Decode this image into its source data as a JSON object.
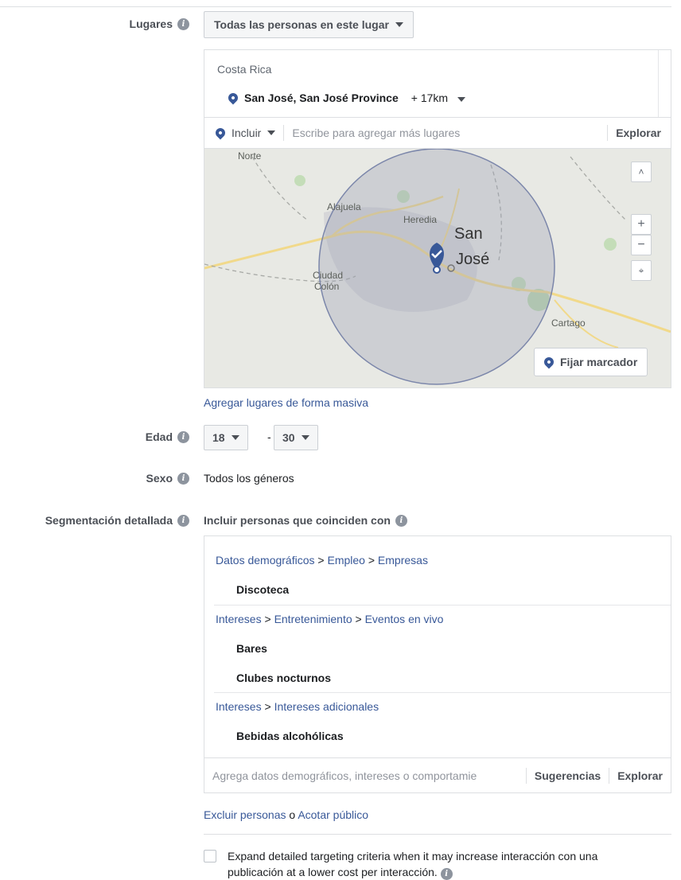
{
  "locations": {
    "label": "Lugares",
    "audience_select": "Todas las personas en este lugar",
    "country": "Costa Rica",
    "city": "San José, San José Province",
    "radius": "+ 17km",
    "include_label": "Incluir",
    "search_placeholder": "Escribe para agregar más lugares",
    "explore": "Explorar",
    "map": {
      "labels": {
        "norte": "Norte",
        "alajuela": "Alajuela",
        "heredia": "Heredia",
        "san": "San",
        "jose": "José",
        "ciudad": "Ciudad",
        "colon": "Colón",
        "cartago": "Cartago"
      },
      "zoom_in": "+",
      "zoom_out": "−",
      "set_pin": "Fijar marcador"
    },
    "bulk_link": "Agregar lugares de forma masiva"
  },
  "age": {
    "label": "Edad",
    "min": "18",
    "separator": "-",
    "max": "30"
  },
  "gender": {
    "label": "Sexo",
    "value": "Todos los géneros"
  },
  "detailed": {
    "label": "Segmentación detallada",
    "include_text": "Incluir personas que coinciden con",
    "groups": [
      {
        "path": [
          "Datos demográficos",
          "Empleo",
          "Empresas"
        ],
        "items": [
          "Discoteca"
        ]
      },
      {
        "path": [
          "Intereses",
          "Entretenimiento",
          "Eventos en vivo"
        ],
        "items": [
          "Bares",
          "Clubes nocturnos"
        ]
      },
      {
        "path": [
          "Intereses",
          "Intereses adicionales"
        ],
        "items": [
          "Bebidas alcohólicas"
        ]
      }
    ],
    "gt": ">",
    "input_placeholder": "Agrega datos demográficos, intereses o comportamie",
    "suggestions": "Sugerencias",
    "explore": "Explorar",
    "exclude_link": "Excluir personas",
    "conj": "o",
    "narrow_link": "Acotar público"
  },
  "expand": {
    "text": "Expand detailed targeting criteria when it may increase interacción con una publicación at a lower cost per interacción."
  },
  "colors": {
    "link": "#385898",
    "pin": "#385898",
    "radius_fill": "#9aa0b4"
  }
}
